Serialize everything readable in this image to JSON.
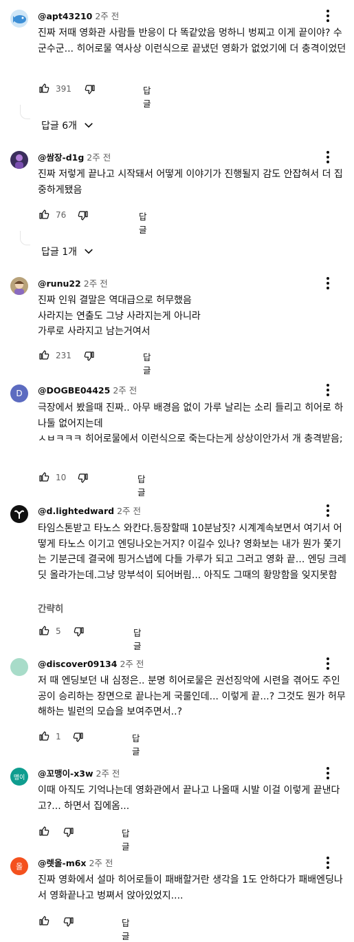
{
  "ui": {
    "reply_label": "답글",
    "show_less_label": "간략히"
  },
  "comments": [
    {
      "handle": "@apt43210",
      "time": "2주 전",
      "avatar": {
        "kind": "image",
        "bg": "#cfe6f7",
        "icon": "blue-fish-avatar"
      },
      "text": "진짜 저때 영화관 사람들 반응이 다 똑같았음 멍하니 벙찌고 이게 끝이야? 수군수군... 히어로물 역사상 이런식으로 끝냈던 영화가 없었기에 더 충격이었던",
      "likes": "391",
      "replies": "답글 6개"
    },
    {
      "handle": "@쌈장-d1g",
      "time": "2주 전",
      "avatar": {
        "kind": "image",
        "bg": "#3a2e5c",
        "icon": "purple-figure-avatar"
      },
      "text": "진짜 저렇게 끝나고 시작돼서 어떻게 이야기가 진행될지 감도 안잡혀서 더 집중하게됐음",
      "likes": "76",
      "replies": "답글 1개"
    },
    {
      "handle": "@runu22",
      "time": "2주 전",
      "avatar": {
        "kind": "image",
        "bg": "#b8a27a",
        "icon": "illustrated-avatar"
      },
      "text": "진짜 인워 결말은 역대급으로 허무했음\n사라지는 연출도 그냥 사라지는게 아니라\n가루로 사라지고 남는거여서",
      "likes": "231"
    },
    {
      "handle": "@DOGBE04425",
      "time": "2주 전",
      "avatar": {
        "kind": "letter",
        "bg": "#5c6bc0",
        "letter": "D"
      },
      "text": "극장에서 봤을때 진짜.. 아무 배경음 없이 가루 날리는 소리 들리고 히어로 하나둘 없어지는데\nㅅㅂㅋㅋㅋ 히어로물에서 이런식으로 죽는다는게 상상이안가서 개 충격받음;",
      "likes": "10"
    },
    {
      "handle": "@d.lightedward",
      "time": "2주 전",
      "avatar": {
        "kind": "image",
        "bg": "#111111",
        "icon": "white-leaf-avatar"
      },
      "text": "타임스톤받고 타노스 와칸다.등장할때 10분남짓? 시계계속보면서 여기서 어떻게 타노스 이기고 엔딩나오는거지? 이길수 있나? 영화보는 내가 뭔가 쫓기는 기분근데 결국에 핑거스냅에 다들 가루가 되고 그러고 영화 끝... 엔딩 크레딧 올라가는데.그냥 망부석이 되어버림... 아직도 그때의 황망함을 잊지못함",
      "likes": "5"
    },
    {
      "handle": "@discover09134",
      "time": "2주 전",
      "avatar": {
        "kind": "blank",
        "bg": "#a8dcc9"
      },
      "text": "저 때 엔딩보던 내 심정은.. 분명 히어로물은 권선징악에 시련을 겪어도 주인공이 승리하는 장면으로 끝나는게 국룰인데... 이렇게 끝...? 그것도 뭔가 허무해하는 빌런의 모습을 보여주면서..?",
      "likes": "1"
    },
    {
      "handle": "@꼬맹이-x3w",
      "time": "2주 전",
      "avatar": {
        "kind": "letter",
        "bg": "#0f9d8f",
        "letter": "맹이"
      },
      "text": "이때 아직도 기억나는데 영화관에서 끝나고 나올때 시발 이걸 이렇게 끝낸다고?... 하면서 집에옴...",
      "likes": ""
    },
    {
      "handle": "@렛올-m6x",
      "time": "2주 전",
      "avatar": {
        "kind": "letter",
        "bg": "#f4511e",
        "letter": "올"
      },
      "text": "진짜 영화에서 설마 히어로들이 패배할거란 생각을 1도 안하다가 패배엔딩나서 영화끝나고 벙쪄서 앉아있었지....",
      "likes": ""
    }
  ]
}
